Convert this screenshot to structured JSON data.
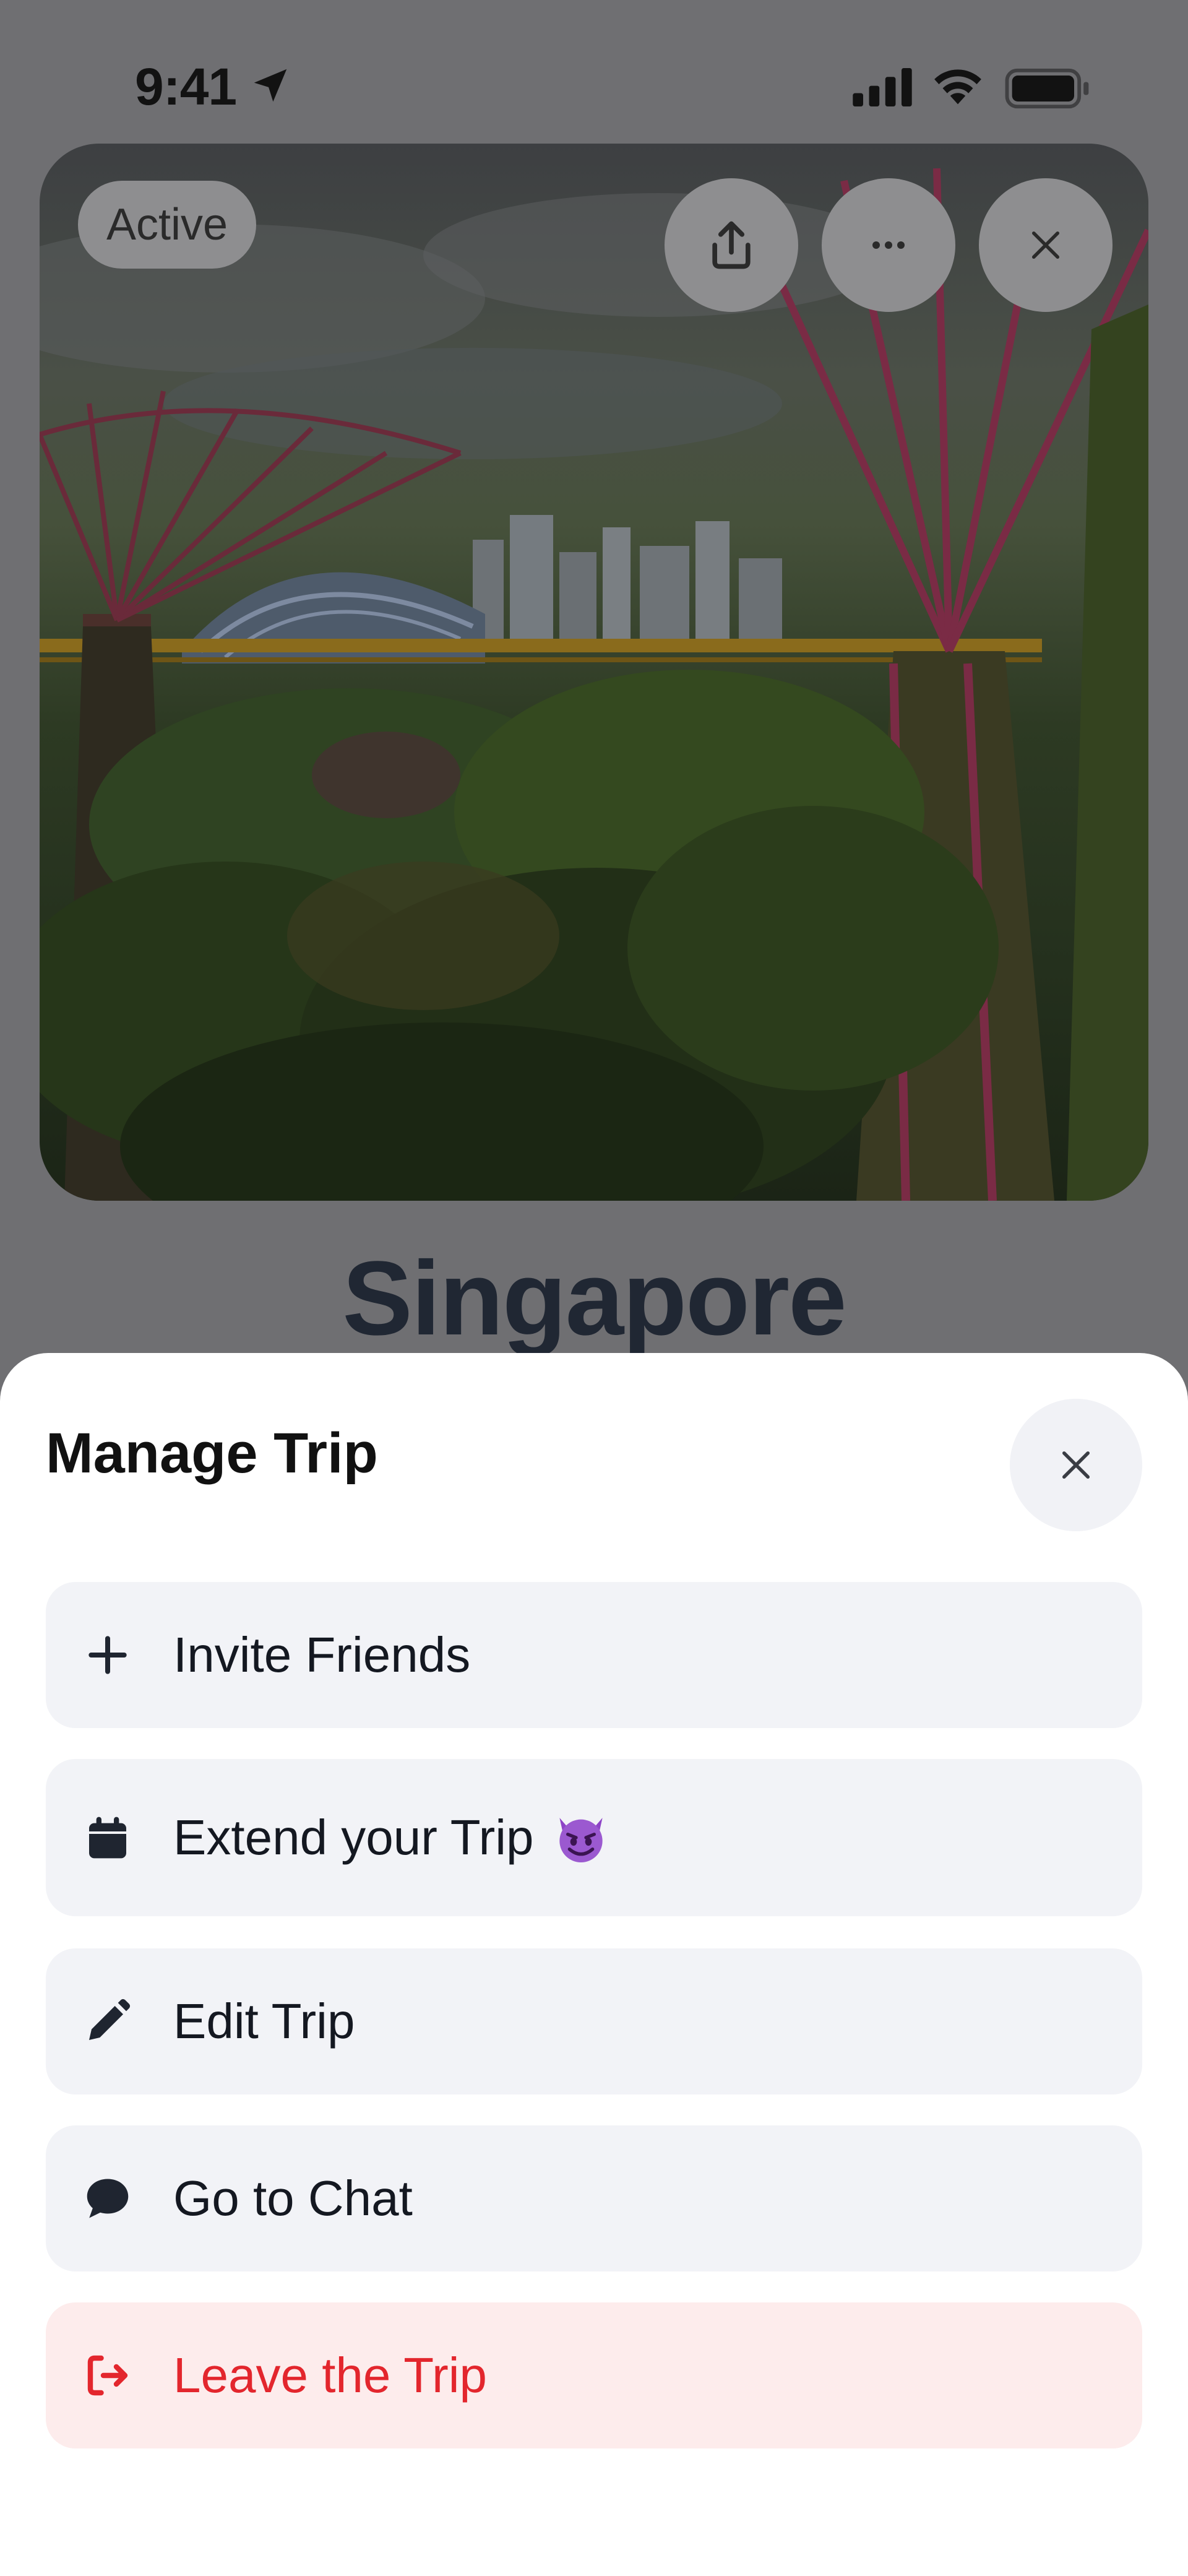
{
  "status_bar": {
    "time": "9:41"
  },
  "trip": {
    "status_badge": "Active",
    "title": "Singapore",
    "actions": [
      {
        "icon": "share-icon"
      },
      {
        "icon": "more-icon"
      },
      {
        "icon": "close-icon"
      }
    ]
  },
  "manage_sheet": {
    "title": "Manage Trip",
    "close_icon": "close-icon",
    "items": [
      {
        "label": "Invite Friends",
        "icon": "plus-icon"
      },
      {
        "label": "Extend your Trip",
        "icon": "calendar-icon",
        "emoji": "devil-emoji"
      },
      {
        "label": "Edit Trip",
        "icon": "pencil-icon"
      },
      {
        "label": "Go to Chat",
        "icon": "chat-bubble-icon"
      },
      {
        "label": "Leave the Trip",
        "icon": "leave-icon"
      }
    ]
  },
  "colors": {
    "overlay": "#6f6f72",
    "sheet_background": "#ffffff",
    "item_background": "#f2f3f7",
    "danger_background": "#fdecec",
    "danger_text": "#e3262d",
    "text_primary": "#141821"
  }
}
